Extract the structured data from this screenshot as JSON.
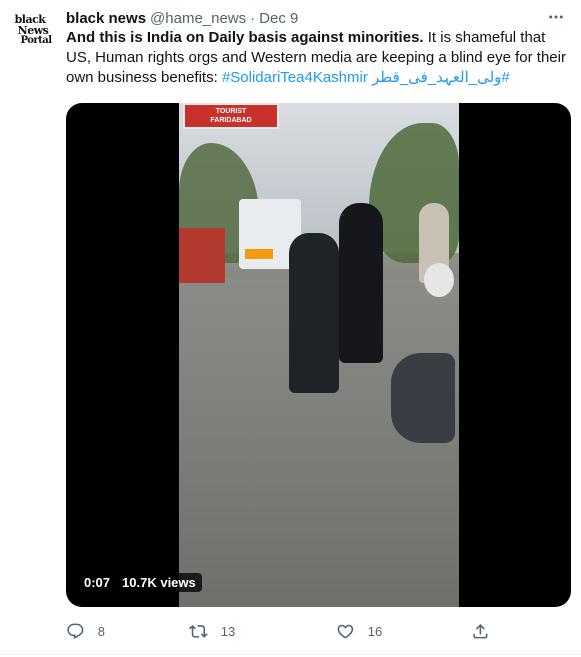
{
  "author": {
    "display_name": "black news",
    "handle": "@hame_news",
    "separator": "·",
    "date": "Dec 9",
    "avatar_lines": [
      "black",
      "News",
      "Portal"
    ]
  },
  "tweet": {
    "bold_text": "And this is India on Daily basis against minorities.",
    "text": " It is shameful that US, Human rights orgs and Western media are keeping a blind eye for their own business benefits: ",
    "hashtags": [
      "#SolidariTea4Kashmir",
      "#ولی_العہد_فی_قطر"
    ]
  },
  "media": {
    "sign_line1": "TOURIST",
    "sign_line2": "FARIDABAD",
    "elapsed": "0:07",
    "views": "10.7K views"
  },
  "actions": {
    "replies": "8",
    "retweets": "13",
    "likes": "16"
  },
  "icons": [
    "more-icon",
    "reply-icon",
    "retweet-icon",
    "like-icon",
    "share-icon"
  ],
  "colors": {
    "accent": "#1d9bf0",
    "secondary_text": "#536471",
    "primary_text": "#0f1419"
  }
}
